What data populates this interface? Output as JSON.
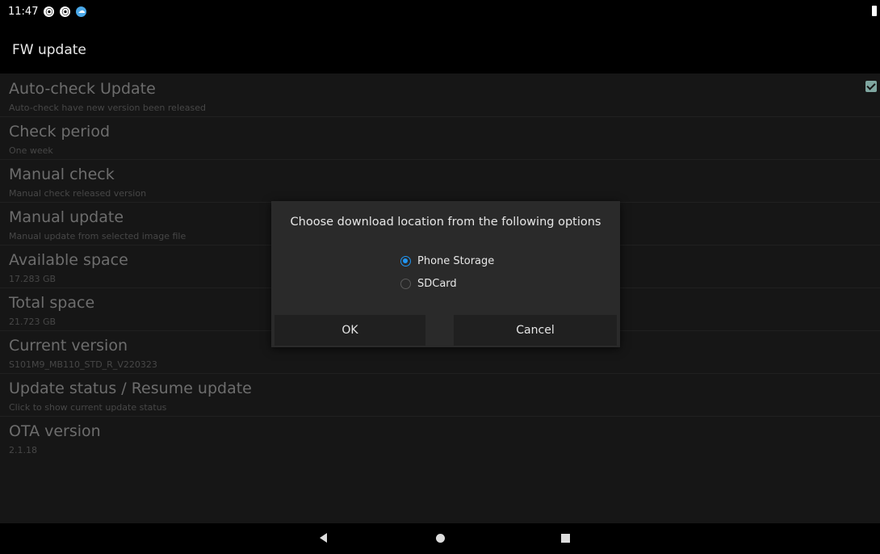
{
  "status_bar": {
    "time": "11:47",
    "icons": [
      "app-notification-icon",
      "app-notification-icon",
      "weather-app-icon"
    ]
  },
  "app_bar": {
    "title": "FW update"
  },
  "preferences": [
    {
      "title": "Auto-check Update",
      "summary": "Auto-check have new version been released",
      "checked": true
    },
    {
      "title": "Check period",
      "summary": "One week"
    },
    {
      "title": "Manual check",
      "summary": "Manual check released version"
    },
    {
      "title": "Manual update",
      "summary": "Manual update from selected image file"
    },
    {
      "title": "Available space",
      "summary": "17.283 GB"
    },
    {
      "title": "Total space",
      "summary": "21.723 GB"
    },
    {
      "title": "Current version",
      "summary": "S101M9_MB110_STD_R_V220323"
    },
    {
      "title": "Update status / Resume update",
      "summary": "Click to show current update status"
    },
    {
      "title": "OTA version",
      "summary": "2.1.18"
    }
  ],
  "dialog": {
    "title": "Choose download location from the following options",
    "options": [
      {
        "label": "Phone Storage",
        "selected": true
      },
      {
        "label": "SDCard",
        "selected": false
      }
    ],
    "ok_label": "OK",
    "cancel_label": "Cancel"
  },
  "colors": {
    "accent": "#2196f3",
    "checkbox": "#7fa6a0",
    "background": "#161616"
  }
}
